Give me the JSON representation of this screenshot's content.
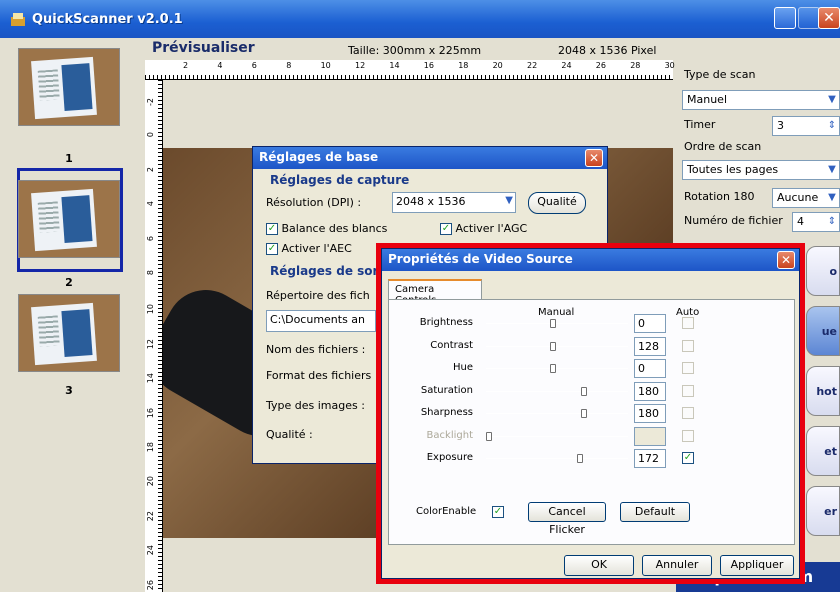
{
  "app": {
    "title": "QuickScanner v2.0.1"
  },
  "thumbs": [
    "1",
    "2",
    "3"
  ],
  "preview": {
    "title": "Prévisualiser",
    "size": "Taille: 300mm x 225mm",
    "pixels": "2048 x 1536 Pixel"
  },
  "ruler": {
    "top": [
      "2",
      "4",
      "6",
      "8",
      "10",
      "12",
      "14",
      "16",
      "18",
      "20",
      "22",
      "24",
      "26",
      "28",
      "30"
    ],
    "left": [
      "-2",
      "0",
      "2",
      "4",
      "6",
      "8",
      "10",
      "12",
      "14",
      "16",
      "18",
      "20",
      "22",
      "24",
      "26"
    ]
  },
  "side": {
    "scan_type_label": "Type de scan",
    "scan_type": "Manuel",
    "timer_label": "Timer",
    "timer": "3",
    "order_label": "Ordre de scan",
    "order": "Toutes les pages",
    "rotation_label": "Rotation 180",
    "rotation": "Aucune",
    "filenum_label": "Numéro de fichier",
    "filenum": "4",
    "btn1": "o",
    "btn2": "ue",
    "btn3": "hot",
    "btn4": "et",
    "btn5": "er",
    "brand": "SpeechiCam"
  },
  "reglages": {
    "title": "Réglages de base",
    "capture_group": "Réglages de capture",
    "resolution_label": "Résolution (DPI) :",
    "resolution": "2048 x 1536",
    "quality_btn": "Qualité",
    "awb": "Balance des blancs",
    "agc": "Activer l'AGC",
    "aec": "Activer l'AEC",
    "output_group": "Réglages de sor",
    "dir_label": "Répertoire des fich",
    "dir_value": "C:\\Documents an",
    "names_label": "Nom des fichiers :",
    "format_label": "Format des fichiers",
    "type_label": "Type des images :",
    "quality_label": "Qualité :"
  },
  "vs": {
    "title": "Propriétés de Video Source",
    "tab": "Camera Controls",
    "manual": "Manual",
    "auto": "Auto",
    "rows": [
      {
        "label": "Brightness",
        "value": "0",
        "pos": 0.47,
        "auto": false,
        "disabled": false
      },
      {
        "label": "Contrast",
        "value": "128",
        "pos": 0.47,
        "auto": false,
        "disabled": false
      },
      {
        "label": "Hue",
        "value": "0",
        "pos": 0.47,
        "auto": false,
        "disabled": false
      },
      {
        "label": "Saturation",
        "value": "180",
        "pos": 0.7,
        "auto": false,
        "disabled": false
      },
      {
        "label": "Sharpness",
        "value": "180",
        "pos": 0.7,
        "auto": false,
        "disabled": false
      },
      {
        "label": "Backlight",
        "value": "",
        "pos": 0.0,
        "auto": false,
        "disabled": true
      },
      {
        "label": "Exposure",
        "value": "172",
        "pos": 0.67,
        "auto": true,
        "disabled": false
      }
    ],
    "colorenable": "ColorEnable",
    "cancel_flicker": "Cancel Flicker",
    "default": "Default",
    "ok": "OK",
    "annuler": "Annuler",
    "appliquer": "Appliquer"
  },
  "colors": {
    "accent_red": "#e8000e",
    "title_blue": "#1d55c7",
    "brand": "#173a94"
  }
}
